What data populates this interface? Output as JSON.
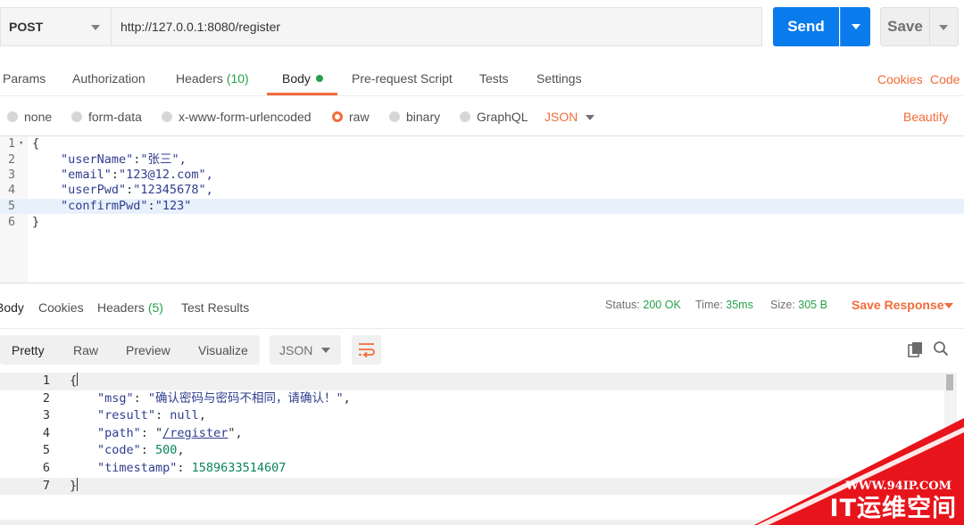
{
  "request": {
    "method": "POST",
    "url": "http://127.0.0.1:8080/register",
    "send_label": "Send",
    "save_label": "Save"
  },
  "request_tabs": {
    "params": "Params",
    "authorization": "Authorization",
    "headers": "Headers",
    "headers_count": "(10)",
    "body": "Body",
    "pre_request": "Pre-request Script",
    "tests": "Tests",
    "settings": "Settings",
    "cookies": "Cookies",
    "code": "Code"
  },
  "body_types": {
    "none": "none",
    "form_data": "form-data",
    "urlencoded": "x-www-form-urlencoded",
    "raw": "raw",
    "binary": "binary",
    "graphql": "GraphQL",
    "format": "JSON",
    "beautify": "Beautify"
  },
  "request_body": {
    "line_numbers": [
      "1",
      "2",
      "3",
      "4",
      "5",
      "6"
    ],
    "open": "{",
    "close": "}",
    "fields": [
      {
        "key": "\"userName\"",
        "value": "\"张三\","
      },
      {
        "key": "\"email\"",
        "value": "\"123@12.com\","
      },
      {
        "key": "\"userPwd\"",
        "value": "\"12345678\","
      },
      {
        "key": "\"confirmPwd\"",
        "value": "\"123\""
      }
    ]
  },
  "response_tabs": {
    "body": "Body",
    "cookies": "Cookies",
    "headers": "Headers",
    "headers_count": "(5)",
    "test_results": "Test Results"
  },
  "response_status": {
    "status_label": "Status:",
    "status_value": "200 OK",
    "time_label": "Time:",
    "time_value": "35ms",
    "size_label": "Size:",
    "size_value": "305 B",
    "save_response": "Save Response"
  },
  "response_view": {
    "pretty": "Pretty",
    "raw": "Raw",
    "preview": "Preview",
    "visualize": "Visualize",
    "format": "JSON"
  },
  "response_body": {
    "line_numbers": [
      "1",
      "2",
      "3",
      "4",
      "5",
      "6",
      "7"
    ],
    "open": "{",
    "close": "}",
    "msg_key": "\"msg\"",
    "msg_value": "\"确认密码与密码不相同，请确认！\"",
    "result_key": "\"result\"",
    "result_value": "null",
    "path_key": "\"path\"",
    "path_value": "/register",
    "code_key": "\"code\"",
    "code_value": "500",
    "timestamp_key": "\"timestamp\"",
    "timestamp_value": "1589633514607"
  },
  "watermark": {
    "url": "WWW.94IP.COM",
    "name": "IT运维空间"
  },
  "colors": {
    "accent": "#f26b3a",
    "send_blue": "#097bed",
    "success_green": "#26a04a",
    "watermark_red": "#e8141c"
  }
}
